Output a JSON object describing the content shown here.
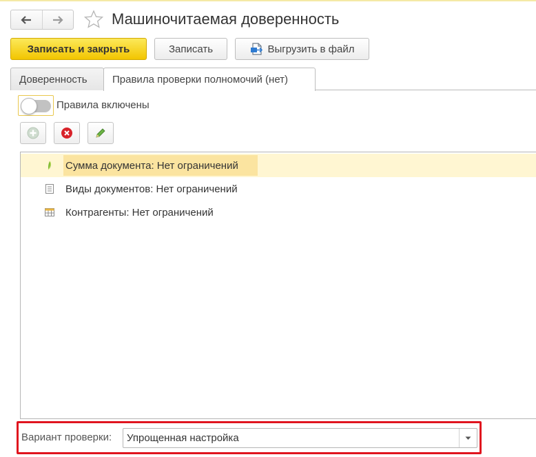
{
  "window": {
    "title": "Машиночитаемая доверенность",
    "nav": {
      "back_icon": "arrow-left-icon",
      "forward_icon": "arrow-right-icon"
    },
    "favorite_icon": "star-icon"
  },
  "toolbar": {
    "save_close_label": "Записать и закрыть",
    "save_label": "Записать",
    "export_label": "Выгрузить в файл",
    "export_icon": "export-file-icon",
    "primary_color": "#f5d327"
  },
  "tabs": [
    {
      "label": "Доверенность",
      "active": false
    },
    {
      "label": "Правила проверки полномочий (нет)",
      "active": true
    }
  ],
  "rules": {
    "toggle_label": "Правила включены",
    "toggle_on": false,
    "buttons": [
      {
        "name": "add",
        "icon": "add-icon",
        "enabled": false
      },
      {
        "name": "delete",
        "icon": "delete-icon",
        "enabled": true
      },
      {
        "name": "edit",
        "icon": "pencil-icon",
        "enabled": true
      }
    ],
    "items": [
      {
        "label": "Сумма документа: Нет ограничений",
        "icon": "amount-icon",
        "selected": true
      },
      {
        "label": "Виды документов: Нет ограничений",
        "icon": "document-icon",
        "selected": false
      },
      {
        "label": "Контрагенты: Нет ограничений",
        "icon": "table-icon",
        "selected": false
      }
    ]
  },
  "check_variant": {
    "label": "Вариант проверки:",
    "value": "Упрощенная настройка",
    "highlight_color": "#e0141e"
  }
}
